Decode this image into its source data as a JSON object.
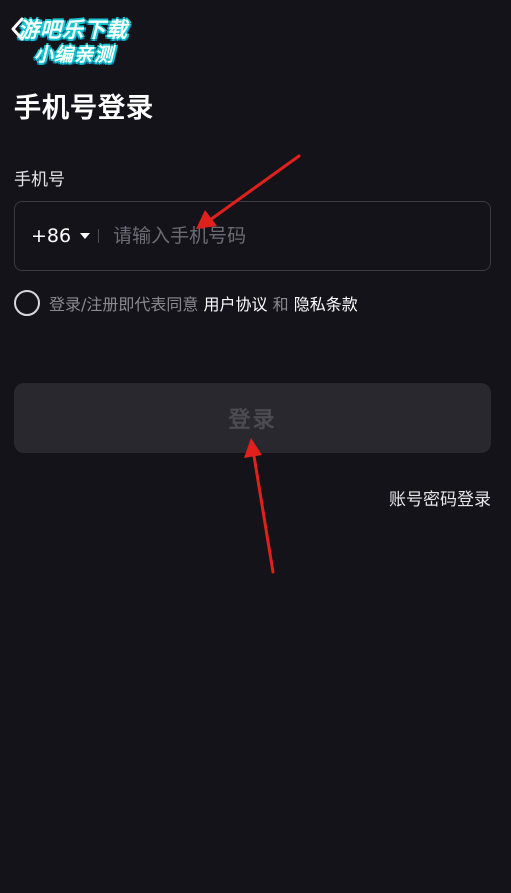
{
  "watermark": {
    "line1": "游吧乐下载",
    "line2": "小编亲测"
  },
  "header": {
    "back_icon": "chevron-left-icon"
  },
  "page": {
    "title": "手机号登录"
  },
  "phone": {
    "label": "手机号",
    "country_code": "+86",
    "placeholder": "请输入手机号码",
    "value": ""
  },
  "agreement": {
    "prefix": "登录/注册即代表同意 ",
    "user_agreement": "用户协议",
    "connector": " 和 ",
    "privacy_policy": "隐私条款",
    "checked": false
  },
  "login_button": {
    "label": "登录",
    "enabled": false
  },
  "alt_login": {
    "label": "账号密码登录"
  },
  "colors": {
    "background": "#14131a",
    "button_disabled": "#29282f",
    "annotation_arrow": "#e0201c",
    "watermark_outline": "#17c8d0"
  }
}
